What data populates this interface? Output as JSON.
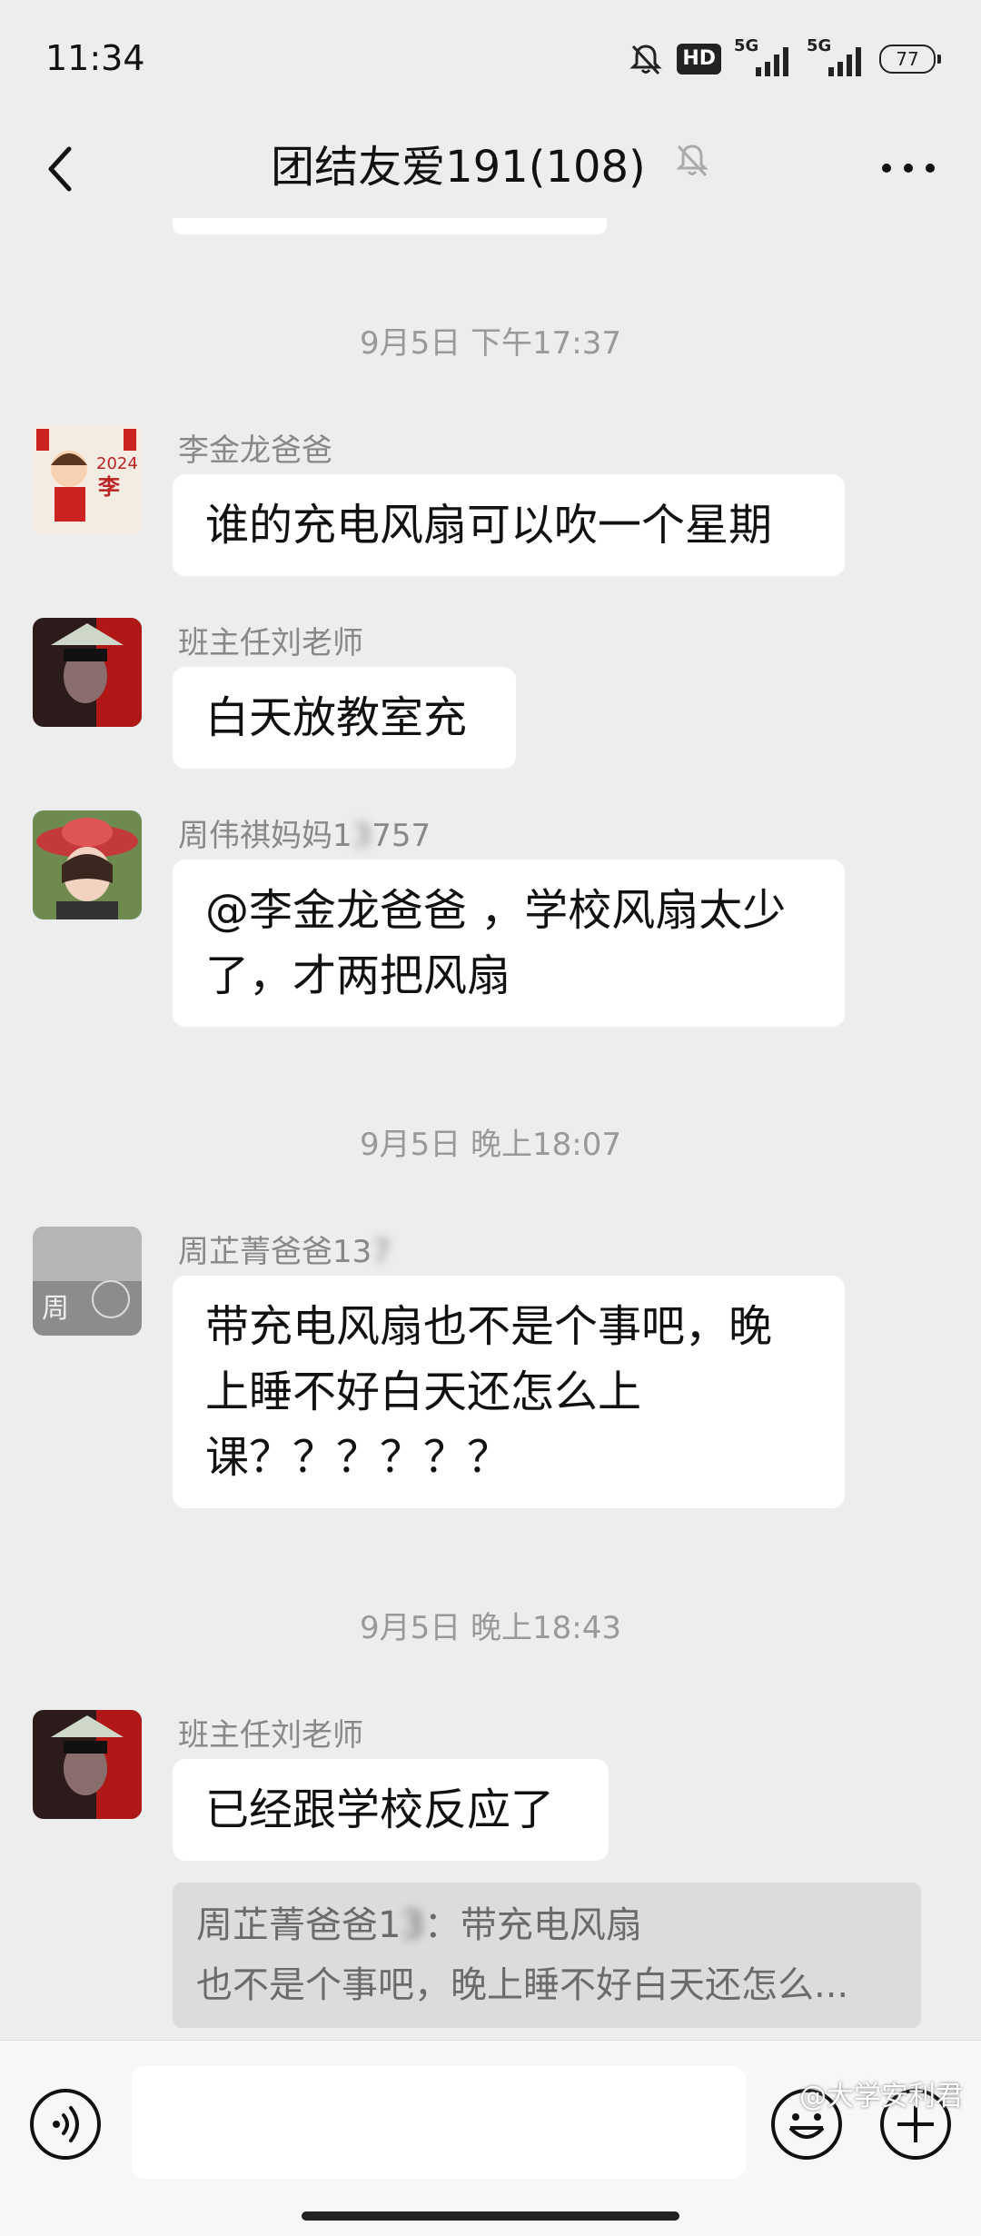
{
  "status_bar": {
    "time": "11:34",
    "hd_label": "HD",
    "network_1": "5G",
    "network_2": "5G",
    "battery": "77"
  },
  "title_bar": {
    "title": "团结友爱191(108)",
    "icons": [
      "back-arrow-icon",
      "mute-bell-icon",
      "more-icon"
    ]
  },
  "chat": {
    "timestamps": [
      "9月5日 下午17:37",
      "9月5日 晚上18:07",
      "9月5日 晚上18:43"
    ],
    "messages": [
      {
        "sender": "李金龙爸爸",
        "text": "谁的充电风扇可以吹一个星期"
      },
      {
        "sender": "班主任刘老师",
        "text": "白天放教室充"
      },
      {
        "sender_visible": "周伟祺妈妈1",
        "sender_obscured": "3",
        "sender_tail": "757",
        "line1": "@李金龙爸爸 ，学校风扇太少",
        "line2": "了，才两把风扇"
      },
      {
        "sender_visible": "周芷菁爸爸13",
        "sender_obscured": "7",
        "line1": "带充电风扇也不是个事吧，晚",
        "line2": "上睡不好白天还怎么上",
        "line3": "课？？？？？？"
      },
      {
        "sender": "班主任刘老师",
        "text": "已经跟学校反应了",
        "quote_line1_visible": "周芷菁爸爸1",
        "quote_line1_obscured": "3",
        "quote_line1_tail": "：带充电风扇",
        "quote_line2": "也不是个事吧，晚上睡不好白天还怎么..."
      }
    ],
    "avatar_label_1": "2024",
    "avatar_char_1": "李",
    "avatar_char_4": "周"
  },
  "input_bar": {
    "icons": [
      "voice-icon",
      "emoji-icon",
      "plus-icon"
    ]
  },
  "watermark": "@大学安利君",
  "colors": {
    "background": "#ededed",
    "bubble": "#ffffff",
    "quote": "#dcdcdc",
    "timestamp": "#999999"
  }
}
